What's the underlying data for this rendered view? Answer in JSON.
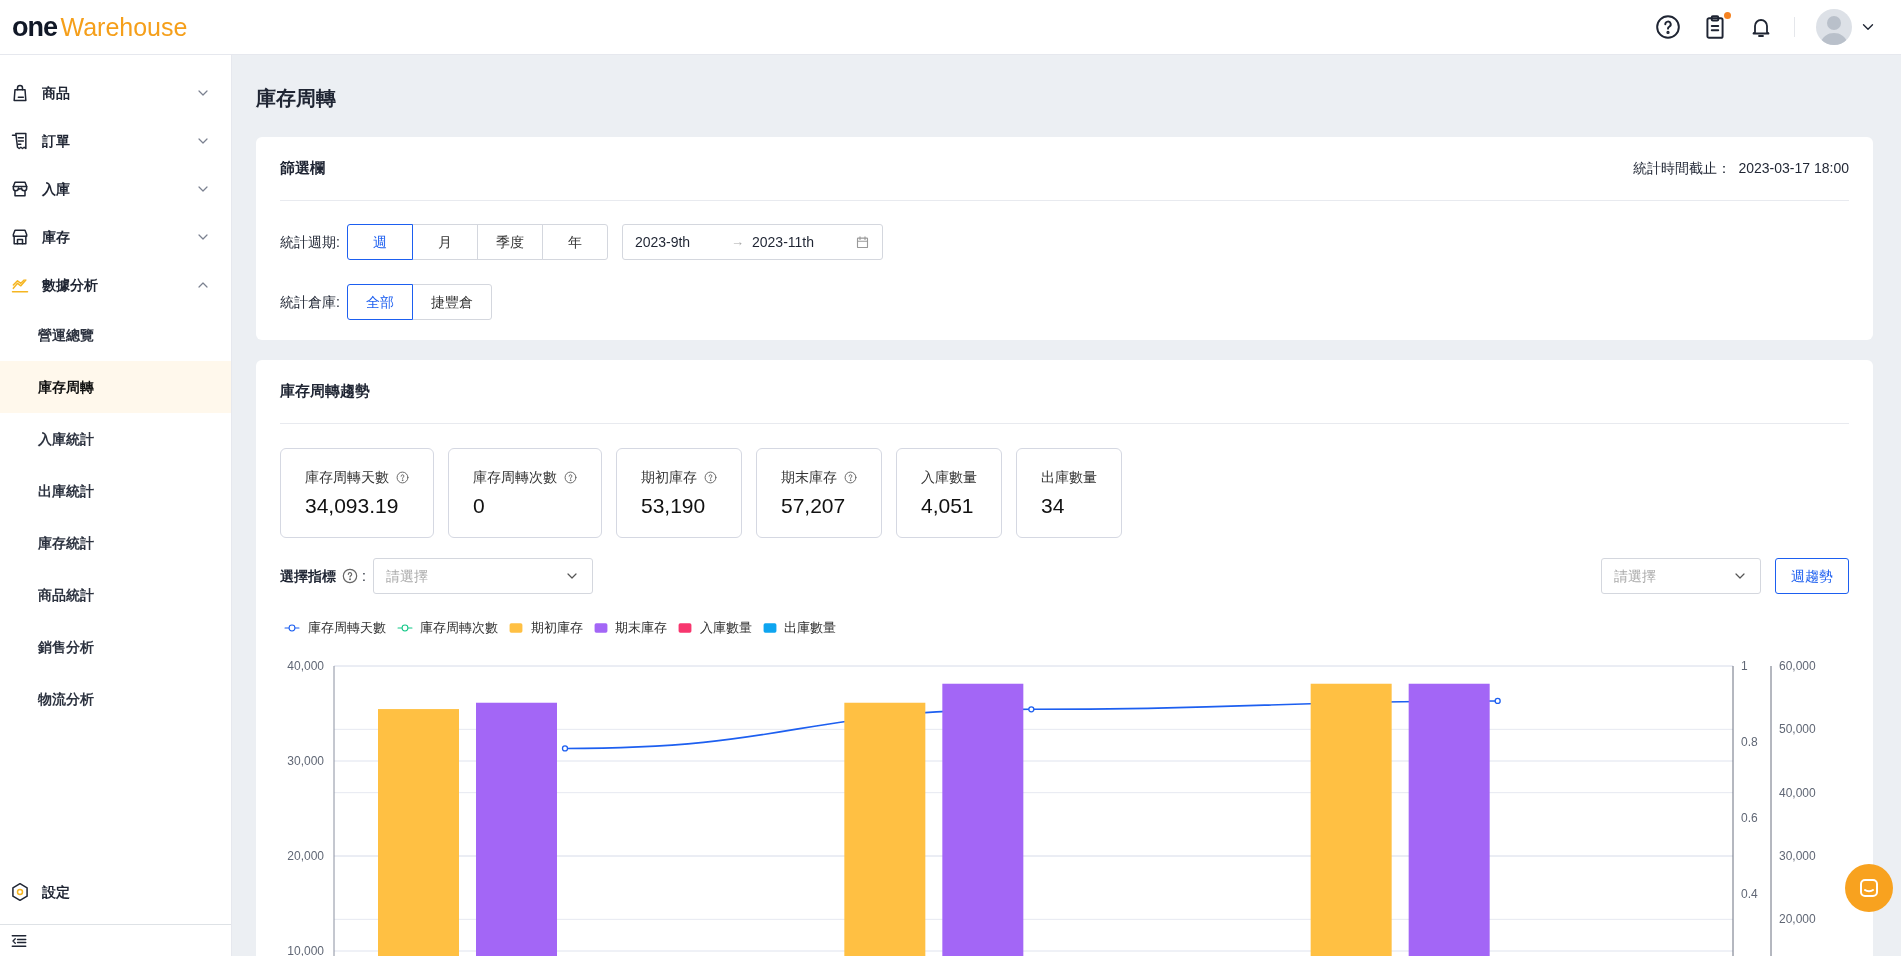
{
  "header": {
    "logo_primary": "one",
    "logo_secondary": "Warehouse",
    "notification_dot": true
  },
  "sidebar": {
    "items": [
      {
        "label": "商品",
        "expanded": false
      },
      {
        "label": "訂單",
        "expanded": false
      },
      {
        "label": "入庫",
        "expanded": false
      },
      {
        "label": "庫存",
        "expanded": false
      },
      {
        "label": "數據分析",
        "expanded": true,
        "children": [
          {
            "label": "營運總覽",
            "selected": false
          },
          {
            "label": "庫存周轉",
            "selected": true
          },
          {
            "label": "入庫統計",
            "selected": false
          },
          {
            "label": "出庫統計",
            "selected": false
          },
          {
            "label": "庫存統計",
            "selected": false
          },
          {
            "label": "商品統計",
            "selected": false
          },
          {
            "label": "銷售分析",
            "selected": false
          },
          {
            "label": "物流分析",
            "selected": false
          }
        ]
      }
    ],
    "footer_item": {
      "label": "設定"
    }
  },
  "page_title": "庫存周轉",
  "filter": {
    "title": "篩選欄",
    "cutoff_label": "統計時間截止：",
    "cutoff_time": "2023-03-17 18:00",
    "period": {
      "label": "統計週期:",
      "options": [
        {
          "label": "週",
          "selected": true
        },
        {
          "label": "月",
          "selected": false
        },
        {
          "label": "季度",
          "selected": false
        },
        {
          "label": "年",
          "selected": false
        }
      ]
    },
    "date_range": {
      "start": "2023-9th",
      "separator": "→",
      "end": "2023-11th"
    },
    "warehouse": {
      "label": "統計倉庫:",
      "options": [
        {
          "label": "全部",
          "selected": true
        },
        {
          "label": "捷豐倉",
          "selected": false
        }
      ]
    }
  },
  "trend": {
    "title": "庫存周轉趨勢",
    "stats": [
      {
        "label": "庫存周轉天數",
        "value": "34,093.19",
        "help": true
      },
      {
        "label": "庫存周轉次數",
        "value": "0",
        "help": true
      },
      {
        "label": "期初庫存",
        "value": "53,190",
        "help": true
      },
      {
        "label": "期末庫存",
        "value": "57,207",
        "help": true
      },
      {
        "label": "入庫數量",
        "value": "4,051",
        "help": false
      },
      {
        "label": "出庫數量",
        "value": "34",
        "help": false
      }
    ],
    "indicator": {
      "label": "選擇指標",
      "colon": ":",
      "placeholder": "請選擇"
    },
    "period_select": {
      "placeholder": "請選擇"
    },
    "trend_button": "週趨勢",
    "chart_data": {
      "type": "bar",
      "stacked": false,
      "grid": true,
      "series": [
        {
          "name": "庫存周轉天數",
          "color": "#1d5ff0",
          "type": "line",
          "marker": "circle",
          "axis": "y2",
          "values": [
            0.783,
            0.886,
            0.908
          ]
        },
        {
          "name": "庫存周轉次數",
          "color": "#13c787",
          "type": "line",
          "marker": "circle",
          "axis": "y2",
          "values": [
            null,
            null,
            null
          ]
        },
        {
          "name": "期初庫存",
          "color": "#ffc043",
          "axis": "y3",
          "values": [
            53200,
            54200,
            57200
          ]
        },
        {
          "name": "期末庫存",
          "color": "#a366f6",
          "axis": "y3",
          "values": [
            54200,
            57200,
            57200
          ]
        },
        {
          "name": "入庫數量",
          "color": "#f7366e",
          "axis": "y3",
          "values": [
            null,
            null,
            null
          ]
        },
        {
          "name": "出庫數量",
          "color": "#0ea5f0",
          "axis": "y3",
          "values": [
            null,
            null,
            null
          ]
        }
      ],
      "ylim": [
        0,
        40000
      ],
      "y2lim": [
        0,
        1
      ],
      "y3lim": [
        0,
        60000
      ],
      "yticks": [
        {
          "value": 10000,
          "label": "10,000"
        },
        {
          "value": 20000,
          "label": "20,000"
        },
        {
          "value": 30000,
          "label": "30,000"
        },
        {
          "value": 40000,
          "label": "40,000"
        }
      ],
      "y2ticks": [
        0.4,
        0.6,
        0.8,
        1
      ],
      "y3ticks": [
        {
          "value": 20000,
          "label": "20,000"
        },
        {
          "value": 30000,
          "label": "30,000"
        },
        {
          "value": 40000,
          "label": "40,000"
        },
        {
          "value": 50000,
          "label": "50,000"
        },
        {
          "value": 60000,
          "label": "60,000"
        }
      ]
    }
  }
}
